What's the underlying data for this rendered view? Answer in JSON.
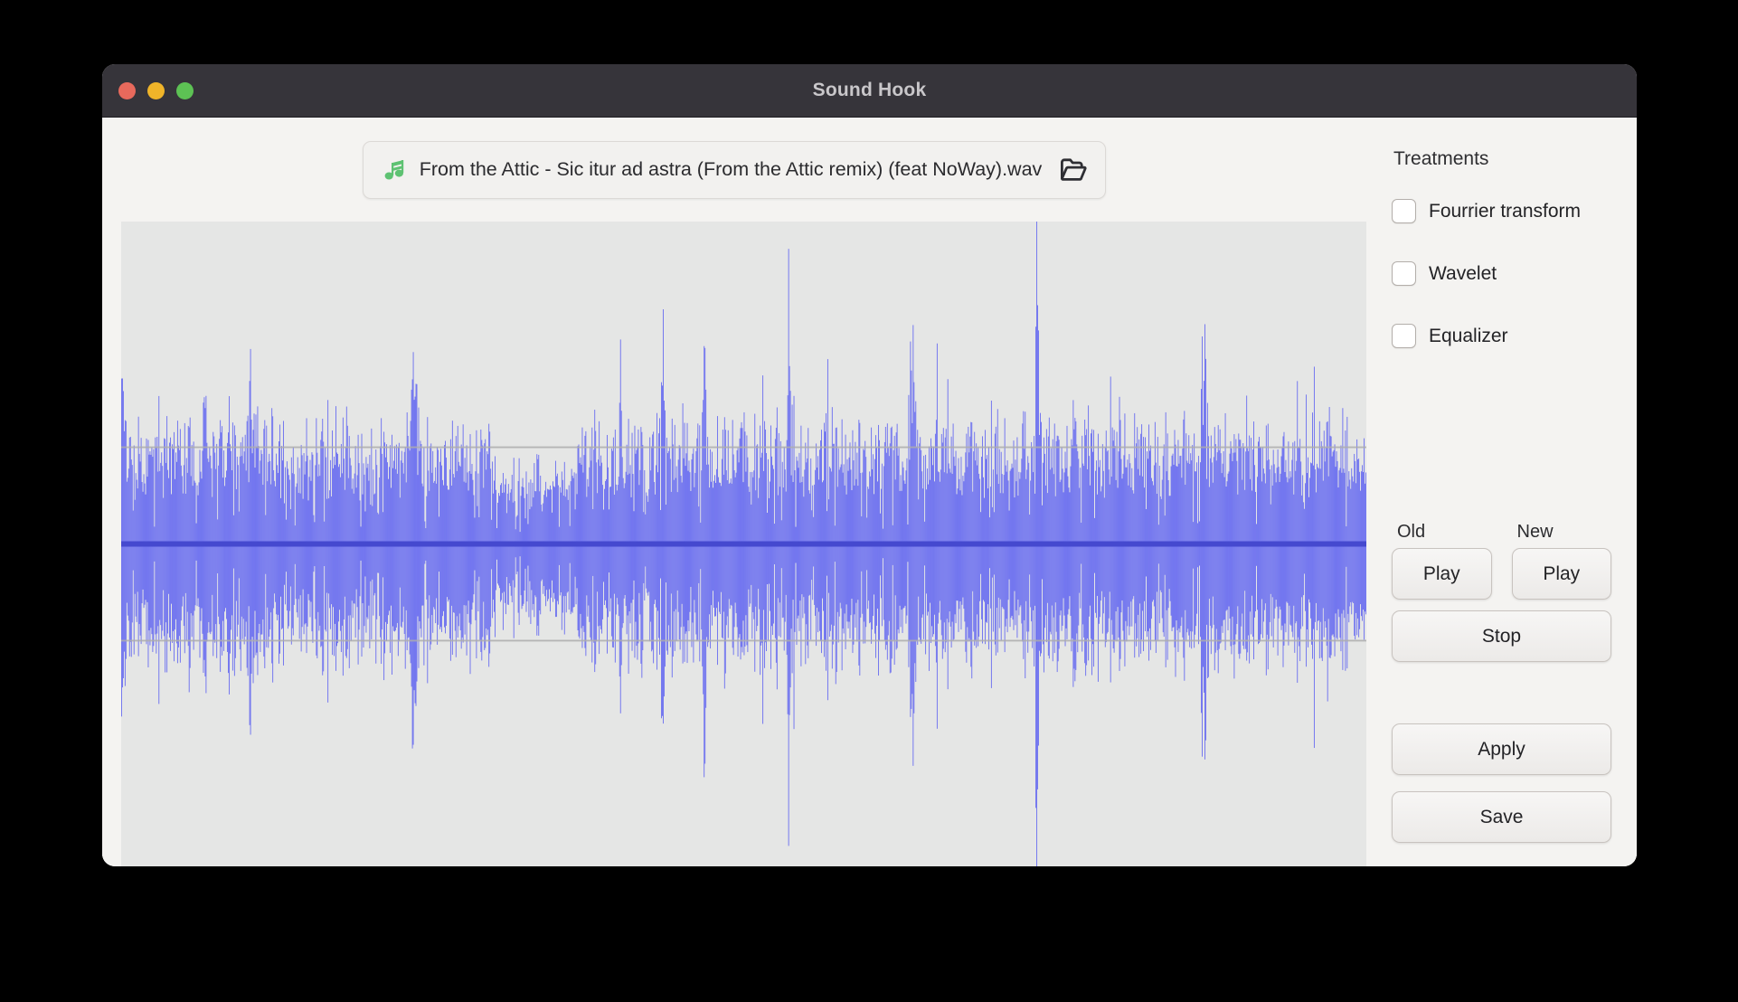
{
  "window": {
    "title": "Sound Hook",
    "traffic_lights": [
      {
        "name": "close-button",
        "color": "#e8695c"
      },
      {
        "name": "minimize-button",
        "color": "#f0b429"
      },
      {
        "name": "maximize-button",
        "color": "#5dc254"
      }
    ]
  },
  "file_chooser": {
    "icon": "music-note-icon",
    "filename": "From the Attic - Sic itur ad astra (From the Attic remix)  (feat NoWay).wav",
    "browse_icon": "open-folder-icon"
  },
  "sidebar": {
    "title": "Treatments",
    "treatments": [
      {
        "label": "Fourrier transform",
        "checked": false
      },
      {
        "label": "Wavelet",
        "checked": false
      },
      {
        "label": "Equalizer",
        "checked": false
      }
    ],
    "playback": {
      "old_label": "Old",
      "new_label": "New",
      "play_old_label": "Play",
      "play_new_label": "Play",
      "stop_label": "Stop"
    },
    "actions": {
      "apply_label": "Apply",
      "save_label": "Save"
    }
  },
  "waveform": {
    "background_color": "#e5e6e5",
    "wave_color": "#6a6ef0",
    "center_line_color": "#4549cf",
    "grid_line_color": "#adadad",
    "grid_lines_normalized": [
      0.35,
      0.65
    ],
    "center_normalized": 0.5,
    "samples": [
      0.93,
      0.42,
      0.27,
      0.33,
      0.3,
      0.26,
      0.31,
      0.35,
      0.29,
      0.24,
      0.33,
      0.38,
      0.28,
      0.26,
      0.34,
      0.3,
      0.25,
      0.36,
      0.31,
      0.27,
      0.29,
      0.35,
      0.4,
      0.26,
      0.31,
      0.28,
      0.37,
      0.33,
      0.29,
      0.24,
      0.3,
      0.35,
      0.46,
      0.33,
      0.29,
      0.27,
      0.34,
      0.31,
      0.38,
      0.28,
      0.26,
      0.33,
      0.3,
      0.36,
      0.29,
      0.25,
      0.32,
      0.28,
      0.35,
      0.62,
      0.41,
      0.3,
      0.58,
      0.36,
      0.29,
      0.33,
      0.27,
      0.31,
      0.38,
      0.26,
      0.34,
      0.29,
      0.3,
      0.36,
      0.28,
      0.25,
      0.33,
      0.31,
      0.27,
      0.35,
      0.3,
      0.38,
      0.26,
      0.29,
      0.34,
      0.32,
      0.28,
      0.36,
      0.3,
      0.27,
      0.33,
      0.29,
      0.35,
      0.31,
      0.26,
      0.38,
      0.3,
      0.34,
      0.28,
      0.32,
      0.29,
      0.36,
      0.27,
      0.33,
      0.3,
      0.35,
      0.41,
      0.28,
      0.32,
      0.36,
      0.29,
      0.34,
      0.3,
      0.27,
      0.33,
      0.38,
      0.31,
      0.26,
      0.35,
      0.29,
      0.32,
      0.28,
      0.99,
      0.52,
      0.36,
      0.3,
      0.33,
      0.27,
      0.35,
      0.31,
      0.29,
      0.38,
      0.26,
      0.33,
      0.3,
      0.36,
      0.28,
      0.32,
      0.29,
      0.35,
      0.27,
      0.31,
      0.34,
      0.3,
      0.38,
      0.26,
      0.33,
      0.29,
      0.36,
      0.31,
      0.28,
      0.34,
      0.3,
      0.27,
      0.22,
      0.18,
      0.2,
      0.24,
      0.17,
      0.21,
      0.19,
      0.23,
      0.16,
      0.22,
      0.18,
      0.25,
      0.2,
      0.17,
      0.23,
      0.19,
      0.26,
      0.21,
      0.18,
      0.24,
      0.2,
      0.27,
      0.17,
      0.22,
      0.25,
      0.19,
      0.23,
      0.21,
      0.18,
      0.26,
      0.2,
      0.24,
      0.3,
      0.35,
      0.28,
      0.33,
      0.26,
      0.31,
      0.38,
      0.29,
      0.34,
      0.27,
      0.32,
      0.36,
      0.3,
      0.25,
      0.33,
      0.29,
      0.55,
      0.34,
      0.29,
      0.32,
      0.26,
      0.36,
      0.3,
      0.28,
      0.33,
      0.38,
      0.27,
      0.31,
      0.35,
      0.29,
      0.26,
      0.32,
      0.68,
      0.41,
      0.31,
      0.28,
      0.35,
      0.3,
      0.26,
      0.33,
      0.38,
      0.29,
      0.32,
      0.27,
      0.36,
      0.3,
      0.34,
      0.28,
      0.9,
      0.46,
      0.33,
      0.3,
      0.27,
      0.35,
      0.31,
      0.29,
      0.38,
      0.26,
      0.33,
      0.3,
      0.36,
      0.28,
      0.32,
      0.34,
      0.44,
      0.3,
      0.27,
      0.34,
      0.31,
      0.28,
      0.36,
      0.29,
      0.33,
      0.26,
      0.35,
      0.3,
      0.38,
      0.27,
      0.32,
      0.29,
      0.36,
      0.58,
      0.34,
      0.3,
      0.28,
      0.33,
      0.27,
      0.38,
      0.31,
      0.35,
      0.29,
      0.26,
      0.34,
      0.3,
      0.32,
      0.36,
      0.62,
      0.38,
      0.3,
      0.34,
      0.28,
      0.31,
      0.36,
      0.27,
      0.33,
      0.3,
      0.38,
      0.26,
      0.34,
      0.29,
      0.32,
      0.35,
      0.3,
      0.27,
      0.33,
      0.38,
      0.29,
      0.26,
      0.35,
      0.31,
      0.34,
      0.28,
      0.3,
      0.36,
      0.27,
      0.33,
      0.29,
      0.38,
      0.72,
      0.45,
      0.32,
      0.28,
      0.35,
      0.3,
      0.26,
      0.33,
      0.29,
      0.37,
      0.31,
      0.27,
      0.34,
      0.3,
      0.36,
      0.28,
      0.33,
      0.3,
      0.26,
      0.35,
      0.31,
      0.38,
      0.28,
      0.33,
      0.29,
      0.36,
      0.27,
      0.32,
      0.3,
      0.34,
      0.26,
      0.38,
      0.31,
      0.27,
      0.35,
      0.3,
      0.33,
      0.29,
      0.36,
      0.28,
      0.34,
      0.26,
      0.31,
      0.38,
      0.3,
      0.27,
      0.35,
      0.32,
      0.96,
      0.5,
      0.34,
      0.3,
      0.27,
      0.33,
      0.38,
      0.29,
      0.31,
      0.35,
      0.26,
      0.34,
      0.3,
      0.28,
      0.36,
      0.32,
      0.29,
      0.33,
      0.27,
      0.38,
      0.31,
      0.3,
      0.35,
      0.26,
      0.34,
      0.29,
      0.32,
      0.36,
      0.28,
      0.3,
      0.33,
      0.27,
      0.38,
      0.31,
      0.34,
      0.29,
      0.26,
      0.35,
      0.3,
      0.33,
      0.28,
      0.36,
      0.27,
      0.32,
      0.38,
      0.3,
      0.29,
      0.34,
      0.26,
      0.31,
      0.35,
      0.28,
      0.33,
      0.3,
      0.38,
      0.27,
      0.32,
      0.36,
      0.29,
      0.34,
      0.26,
      0.3,
      0.33,
      0.31,
      0.8,
      0.48,
      0.35,
      0.29,
      0.32,
      0.27,
      0.38,
      0.3,
      0.33,
      0.36,
      0.28,
      0.31,
      0.34,
      0.26,
      0.35,
      0.3,
      0.29,
      0.38,
      0.32,
      0.27,
      0.33,
      0.36,
      0.3,
      0.28,
      0.34,
      0.31,
      0.26,
      0.35,
      0.29,
      0.38,
      0.32,
      0.3,
      0.27,
      0.33,
      0.36,
      0.28,
      0.34,
      0.3,
      0.31,
      0.26,
      0.38,
      0.29,
      0.35,
      0.32,
      0.27,
      0.33,
      0.3,
      0.36,
      0.41,
      0.28,
      0.34,
      0.31,
      0.26,
      0.3,
      0.38,
      0.29,
      0.35,
      0.27,
      0.32,
      0.33,
      0.36,
      0.28,
      0.3,
      0.34
    ]
  }
}
